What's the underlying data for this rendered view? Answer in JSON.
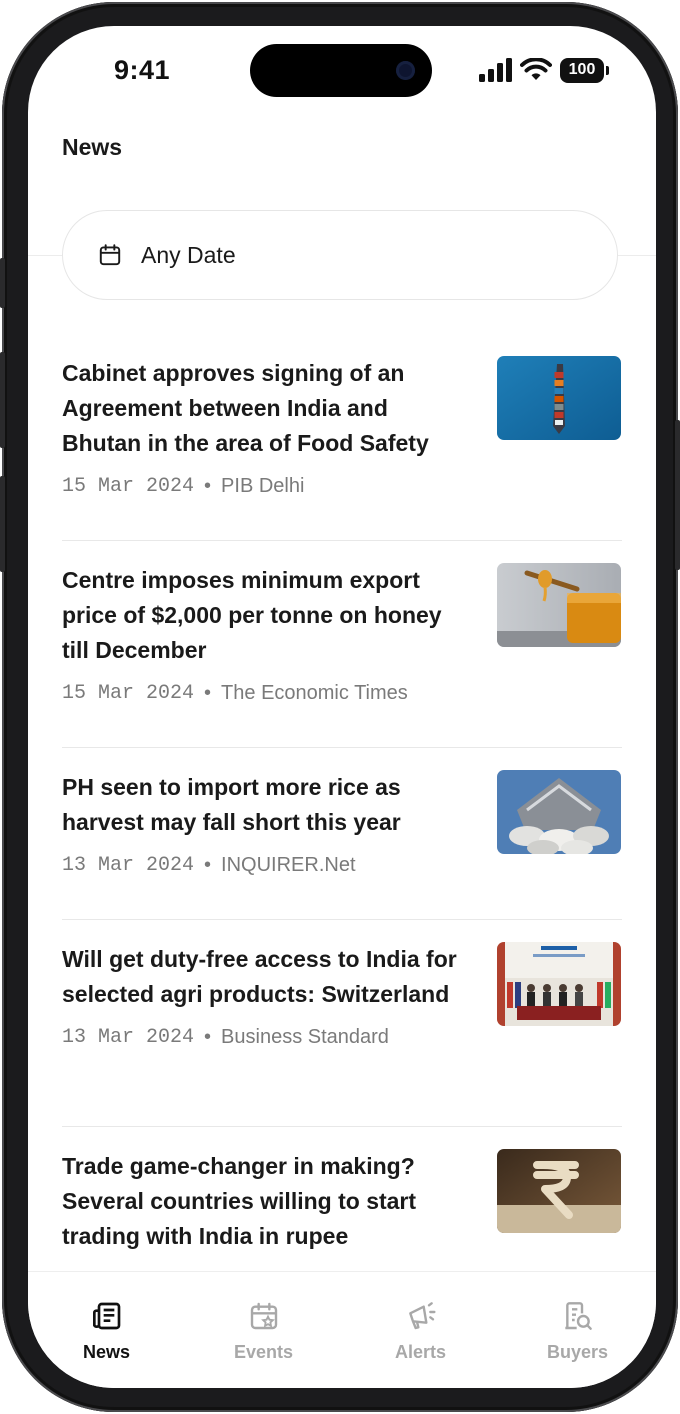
{
  "status_bar": {
    "time": "9:41",
    "battery": "100"
  },
  "header": {
    "title": "News"
  },
  "filter": {
    "date_label": "Any Date"
  },
  "news": [
    {
      "headline": "Cabinet approves signing of an Agreement between India and Bhutan in the area of Food Safety",
      "date": "15 Mar 2024",
      "source": "PIB Delhi",
      "image_icon": "cargo-ship-image"
    },
    {
      "headline": "Centre imposes minimum export price of $2,000 per tonne on honey till December",
      "date": "15 Mar 2024",
      "source": "The Economic Times",
      "image_icon": "honey-jar-image"
    },
    {
      "headline": "PH seen to import more rice as harvest may fall short this year",
      "date": "13 Mar 2024",
      "source": "INQUIRER.Net",
      "image_icon": "rice-sacks-image"
    },
    {
      "headline": "Will get duty-free access to India for selected agri products: Switzerland",
      "date": "13 Mar 2024",
      "source": "Business Standard",
      "image_icon": "signing-ceremony-image"
    },
    {
      "headline": "Trade game-changer in making? Several countries willing to start trading with India in rupee",
      "date": "",
      "source": "",
      "image_icon": "rupee-symbol-image"
    }
  ],
  "bottom_nav": [
    {
      "label": "News",
      "icon": "newspaper-icon",
      "active": true
    },
    {
      "label": "Events",
      "icon": "calendar-star-icon",
      "active": false
    },
    {
      "label": "Alerts",
      "icon": "megaphone-icon",
      "active": false
    },
    {
      "label": "Buyers",
      "icon": "building-search-icon",
      "active": false
    }
  ],
  "colors": {
    "active": "#111111",
    "inactive": "#a8a8a8",
    "divider": "#e8e8e8",
    "meta_text": "#7a7a7a"
  }
}
